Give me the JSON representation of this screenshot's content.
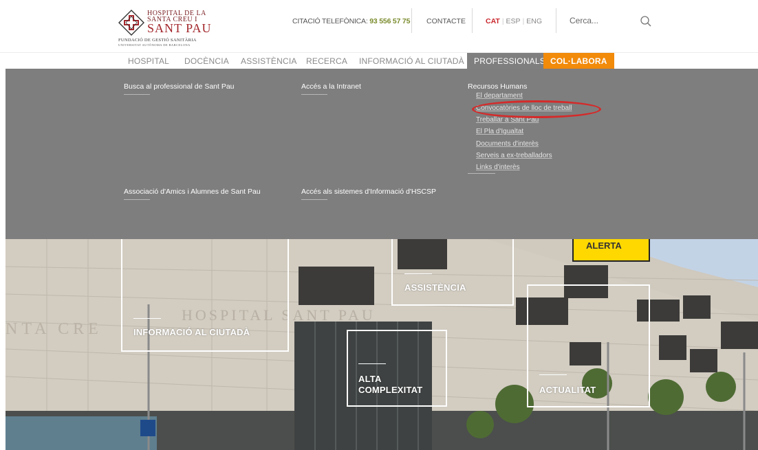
{
  "logo": {
    "line1": "HOSPITAL DE LA",
    "line2": "SANTA CREU I",
    "line3": "SANT PAU",
    "foundation": "FUNDACIÓ DE GESTIÓ SANITÀRIA",
    "university": "UNIVERSITAT AUTÒNOMA DE BARCELONA"
  },
  "header": {
    "phone_label": "CITACIÓ TELEFÒNICA: ",
    "phone_number": "93 556 57 75",
    "contact_label": "CONTACTE",
    "languages": {
      "current": "CAT",
      "others": [
        "ESP",
        "ENG"
      ],
      "separator": "|"
    },
    "search_placeholder": "Cerca..."
  },
  "nav": {
    "items": [
      "HOSPITAL",
      "DOCÈNCIA",
      "ASSISTÈNCIA",
      "RECERCA",
      "INFORMACIÓ AL CIUTADÀ",
      "PROFESSIONALS",
      "COL·LABORA"
    ],
    "active": "PROFESSIONALS",
    "accent": "COL·LABORA"
  },
  "mega_menu": {
    "links": [
      "Busca al professional de Sant Pau",
      "Accés a la Intranet",
      "Associació d'Amics i Alumnes de Sant Pau",
      "Accés als sistemes d'Informació d'HSCSP"
    ],
    "section_title": "Recursos Humans",
    "section_items": [
      "El departament",
      "Convocatòries de lloc de treball",
      "Treballar a Sant Pau",
      "El Pla d'Igualtat",
      "Documents d'interès",
      "Serveis a ex-treballadors",
      "Links d'interès"
    ],
    "highlighted_item": "Convocatòries de lloc de treball"
  },
  "hero": {
    "tiles": [
      "ASSISTÈNCIA",
      "INFORMACIÓ AL CIUTADÀ",
      "ALTA",
      "COMPLEXITAT",
      "ACTUALITAT"
    ],
    "alert_label": "ALERTA",
    "building_lettering": "HOSPITAL SANT PAU",
    "facade_lettering": "NTA CRE"
  },
  "colors": {
    "brand_red": "#a3262b",
    "phone_green": "#7a8c2e",
    "active_nav": "#7f7f7f",
    "accent_orange": "#f28a0a",
    "alert_yellow": "#ffd800",
    "highlight_red": "#d52a2a"
  },
  "icons": {
    "logo": "hospital-cross-emblem-icon",
    "search": "magnifier-icon"
  }
}
